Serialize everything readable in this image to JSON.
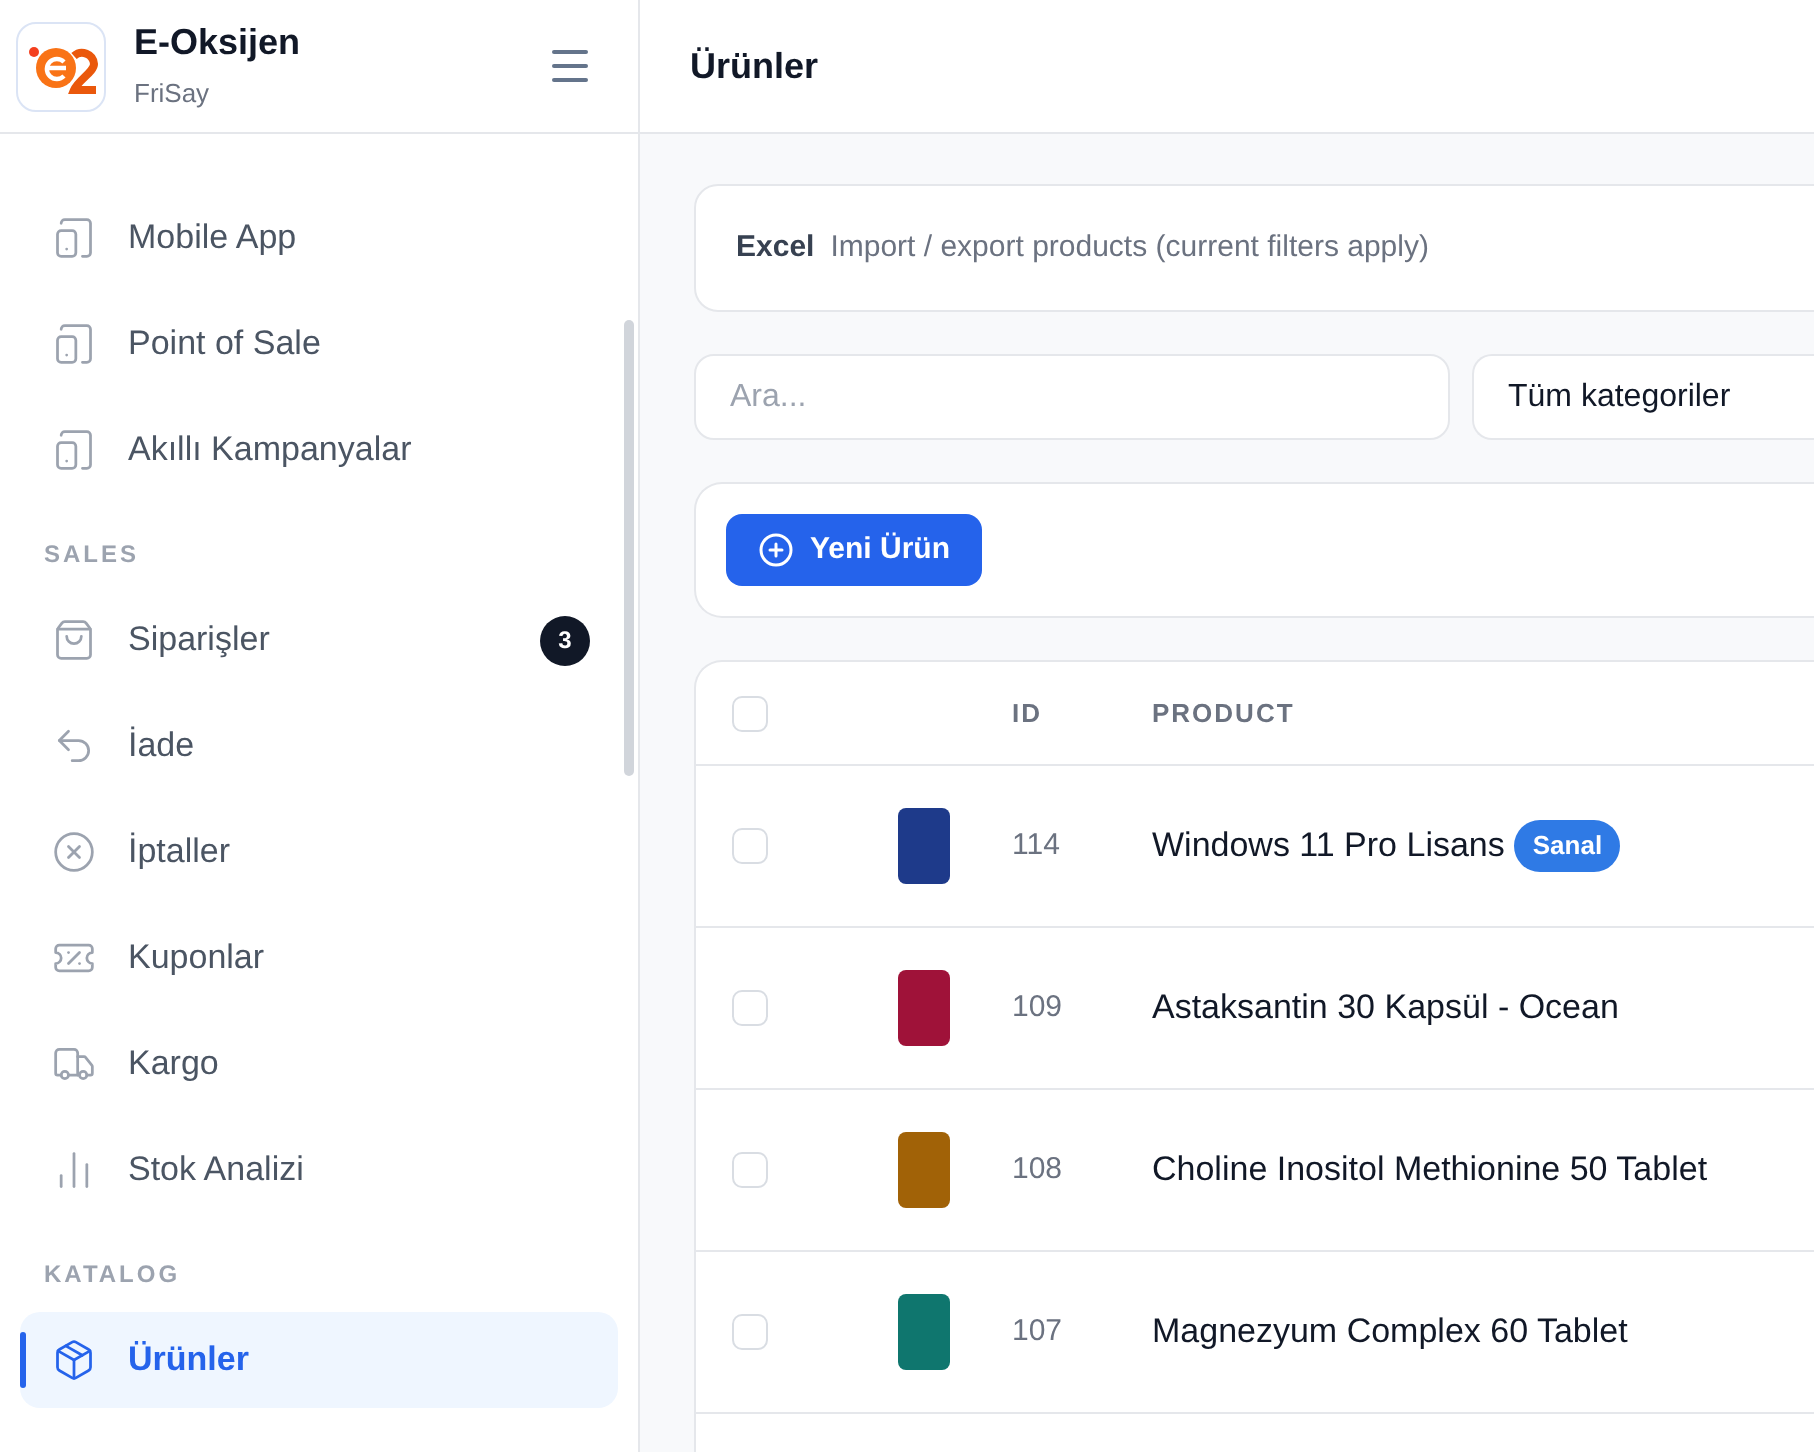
{
  "brand": {
    "name": "E-Oksijen",
    "subtitle": "FriSay"
  },
  "sidebar": {
    "sections": [
      {
        "items": [
          {
            "label": "Mobile App",
            "selected": false
          },
          {
            "label": "Point of Sale",
            "selected": false
          },
          {
            "label": "Akıllı Kampanyalar",
            "selected": false
          }
        ]
      },
      {
        "heading": "SALES",
        "items": [
          {
            "label": "Siparişler",
            "selected": false,
            "badge": "3"
          },
          {
            "label": "İade",
            "selected": false
          },
          {
            "label": "İptaller",
            "selected": false
          },
          {
            "label": "Kuponlar",
            "selected": false
          },
          {
            "label": "Kargo",
            "selected": false
          },
          {
            "label": "Stok Analizi",
            "selected": false
          }
        ]
      },
      {
        "heading": "KATALOG",
        "items": [
          {
            "label": "Ürünler",
            "selected": true
          }
        ]
      }
    ]
  },
  "page": {
    "title": "Ürünler"
  },
  "excel": {
    "label": "Excel",
    "description": "Import / export products (current filters apply)"
  },
  "search": {
    "placeholder": "Ara..."
  },
  "category_select": {
    "value": "Tüm kategoriler"
  },
  "new_button": {
    "label": "Yeni Ürün"
  },
  "table": {
    "all_checked": false,
    "columns": [
      "ID",
      "PRODUCT"
    ],
    "rows": [
      {
        "checked": false,
        "id": "114",
        "product": "Windows 11 Pro Lisans",
        "tag": "Sanal"
      },
      {
        "checked": false,
        "id": "109",
        "product": "Astaksantin 30 Kapsül - Ocean"
      },
      {
        "checked": false,
        "id": "108",
        "product": "Choline Inositol Methionine 50 Tablet"
      },
      {
        "checked": false,
        "id": "107",
        "product": "Magnezyum Complex 60 Tablet"
      }
    ]
  }
}
